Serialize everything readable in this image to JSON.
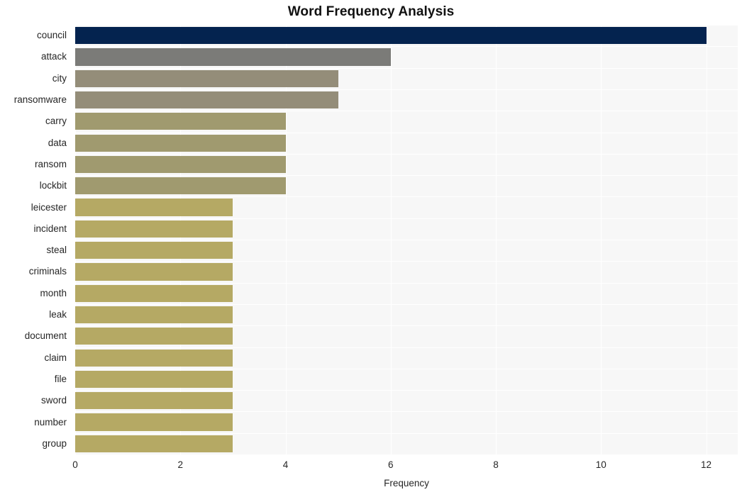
{
  "chart_data": {
    "type": "bar",
    "orientation": "horizontal",
    "title": "Word Frequency Analysis",
    "xlabel": "Frequency",
    "ylabel": "",
    "xlim": [
      0,
      12.6
    ],
    "ylim": null,
    "grid": true,
    "legend": null,
    "xticks": [
      0,
      2,
      4,
      6,
      8,
      10,
      12
    ],
    "xtick_labels": [
      "0",
      "2",
      "4",
      "6",
      "8",
      "10",
      "12"
    ],
    "categories": [
      "council",
      "attack",
      "city",
      "ransomware",
      "carry",
      "data",
      "ransom",
      "lockbit",
      "leicester",
      "incident",
      "steal",
      "criminals",
      "month",
      "leak",
      "document",
      "claim",
      "file",
      "sword",
      "number",
      "group"
    ],
    "values": [
      12,
      6,
      5,
      5,
      4,
      4,
      4,
      4,
      3,
      3,
      3,
      3,
      3,
      3,
      3,
      3,
      3,
      3,
      3,
      3
    ],
    "bar_colors": [
      "#04234f",
      "#7b7b78",
      "#948d79",
      "#948d79",
      "#a09a6f",
      "#a09a6f",
      "#a09a6f",
      "#a09a6f",
      "#b5a964",
      "#b5a964",
      "#b5a964",
      "#b5a964",
      "#b5a964",
      "#b5a964",
      "#b5a964",
      "#b5a964",
      "#b5a964",
      "#b5a964",
      "#b5a964",
      "#b5a964"
    ]
  },
  "style": {
    "plot_background": "#f7f7f7",
    "figure_background": "#ffffff",
    "gridline_color": "#ffffff",
    "text_color": "#262626",
    "title_color": "#111111"
  }
}
